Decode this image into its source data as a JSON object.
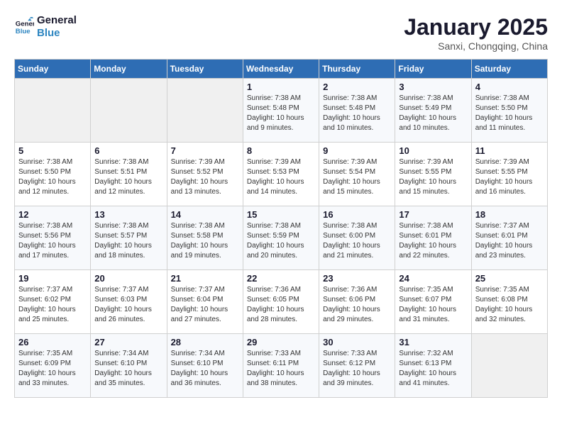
{
  "header": {
    "logo_line1": "General",
    "logo_line2": "Blue",
    "month": "January 2025",
    "location": "Sanxi, Chongqing, China"
  },
  "weekdays": [
    "Sunday",
    "Monday",
    "Tuesday",
    "Wednesday",
    "Thursday",
    "Friday",
    "Saturday"
  ],
  "weeks": [
    [
      {
        "day": "",
        "text": ""
      },
      {
        "day": "",
        "text": ""
      },
      {
        "day": "",
        "text": ""
      },
      {
        "day": "1",
        "text": "Sunrise: 7:38 AM\nSunset: 5:48 PM\nDaylight: 10 hours\nand 9 minutes."
      },
      {
        "day": "2",
        "text": "Sunrise: 7:38 AM\nSunset: 5:48 PM\nDaylight: 10 hours\nand 10 minutes."
      },
      {
        "day": "3",
        "text": "Sunrise: 7:38 AM\nSunset: 5:49 PM\nDaylight: 10 hours\nand 10 minutes."
      },
      {
        "day": "4",
        "text": "Sunrise: 7:38 AM\nSunset: 5:50 PM\nDaylight: 10 hours\nand 11 minutes."
      }
    ],
    [
      {
        "day": "5",
        "text": "Sunrise: 7:38 AM\nSunset: 5:50 PM\nDaylight: 10 hours\nand 12 minutes."
      },
      {
        "day": "6",
        "text": "Sunrise: 7:38 AM\nSunset: 5:51 PM\nDaylight: 10 hours\nand 12 minutes."
      },
      {
        "day": "7",
        "text": "Sunrise: 7:39 AM\nSunset: 5:52 PM\nDaylight: 10 hours\nand 13 minutes."
      },
      {
        "day": "8",
        "text": "Sunrise: 7:39 AM\nSunset: 5:53 PM\nDaylight: 10 hours\nand 14 minutes."
      },
      {
        "day": "9",
        "text": "Sunrise: 7:39 AM\nSunset: 5:54 PM\nDaylight: 10 hours\nand 15 minutes."
      },
      {
        "day": "10",
        "text": "Sunrise: 7:39 AM\nSunset: 5:55 PM\nDaylight: 10 hours\nand 15 minutes."
      },
      {
        "day": "11",
        "text": "Sunrise: 7:39 AM\nSunset: 5:55 PM\nDaylight: 10 hours\nand 16 minutes."
      }
    ],
    [
      {
        "day": "12",
        "text": "Sunrise: 7:38 AM\nSunset: 5:56 PM\nDaylight: 10 hours\nand 17 minutes."
      },
      {
        "day": "13",
        "text": "Sunrise: 7:38 AM\nSunset: 5:57 PM\nDaylight: 10 hours\nand 18 minutes."
      },
      {
        "day": "14",
        "text": "Sunrise: 7:38 AM\nSunset: 5:58 PM\nDaylight: 10 hours\nand 19 minutes."
      },
      {
        "day": "15",
        "text": "Sunrise: 7:38 AM\nSunset: 5:59 PM\nDaylight: 10 hours\nand 20 minutes."
      },
      {
        "day": "16",
        "text": "Sunrise: 7:38 AM\nSunset: 6:00 PM\nDaylight: 10 hours\nand 21 minutes."
      },
      {
        "day": "17",
        "text": "Sunrise: 7:38 AM\nSunset: 6:01 PM\nDaylight: 10 hours\nand 22 minutes."
      },
      {
        "day": "18",
        "text": "Sunrise: 7:37 AM\nSunset: 6:01 PM\nDaylight: 10 hours\nand 23 minutes."
      }
    ],
    [
      {
        "day": "19",
        "text": "Sunrise: 7:37 AM\nSunset: 6:02 PM\nDaylight: 10 hours\nand 25 minutes."
      },
      {
        "day": "20",
        "text": "Sunrise: 7:37 AM\nSunset: 6:03 PM\nDaylight: 10 hours\nand 26 minutes."
      },
      {
        "day": "21",
        "text": "Sunrise: 7:37 AM\nSunset: 6:04 PM\nDaylight: 10 hours\nand 27 minutes."
      },
      {
        "day": "22",
        "text": "Sunrise: 7:36 AM\nSunset: 6:05 PM\nDaylight: 10 hours\nand 28 minutes."
      },
      {
        "day": "23",
        "text": "Sunrise: 7:36 AM\nSunset: 6:06 PM\nDaylight: 10 hours\nand 29 minutes."
      },
      {
        "day": "24",
        "text": "Sunrise: 7:35 AM\nSunset: 6:07 PM\nDaylight: 10 hours\nand 31 minutes."
      },
      {
        "day": "25",
        "text": "Sunrise: 7:35 AM\nSunset: 6:08 PM\nDaylight: 10 hours\nand 32 minutes."
      }
    ],
    [
      {
        "day": "26",
        "text": "Sunrise: 7:35 AM\nSunset: 6:09 PM\nDaylight: 10 hours\nand 33 minutes."
      },
      {
        "day": "27",
        "text": "Sunrise: 7:34 AM\nSunset: 6:10 PM\nDaylight: 10 hours\nand 35 minutes."
      },
      {
        "day": "28",
        "text": "Sunrise: 7:34 AM\nSunset: 6:10 PM\nDaylight: 10 hours\nand 36 minutes."
      },
      {
        "day": "29",
        "text": "Sunrise: 7:33 AM\nSunset: 6:11 PM\nDaylight: 10 hours\nand 38 minutes."
      },
      {
        "day": "30",
        "text": "Sunrise: 7:33 AM\nSunset: 6:12 PM\nDaylight: 10 hours\nand 39 minutes."
      },
      {
        "day": "31",
        "text": "Sunrise: 7:32 AM\nSunset: 6:13 PM\nDaylight: 10 hours\nand 41 minutes."
      },
      {
        "day": "",
        "text": ""
      }
    ]
  ]
}
